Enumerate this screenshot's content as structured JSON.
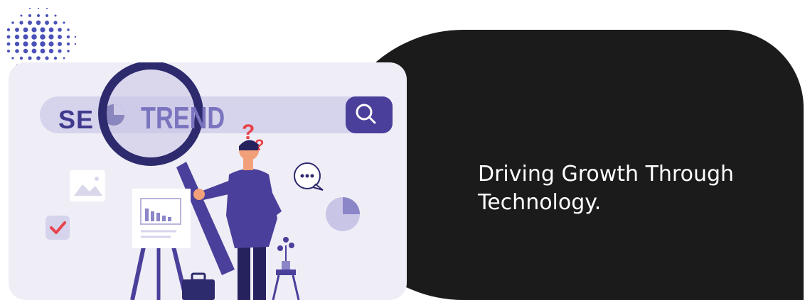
{
  "tagline": "Driving Growth Through Technology.",
  "illustration": {
    "seo_label": "SE",
    "search_term": "TREND",
    "colors": {
      "card_bg": "#efeef7",
      "search_bar": "#d6d3ec",
      "brand_purple": "#4a3f9a",
      "accent_red": "#e8424a",
      "dark_panel": "#1b1b1b"
    }
  }
}
